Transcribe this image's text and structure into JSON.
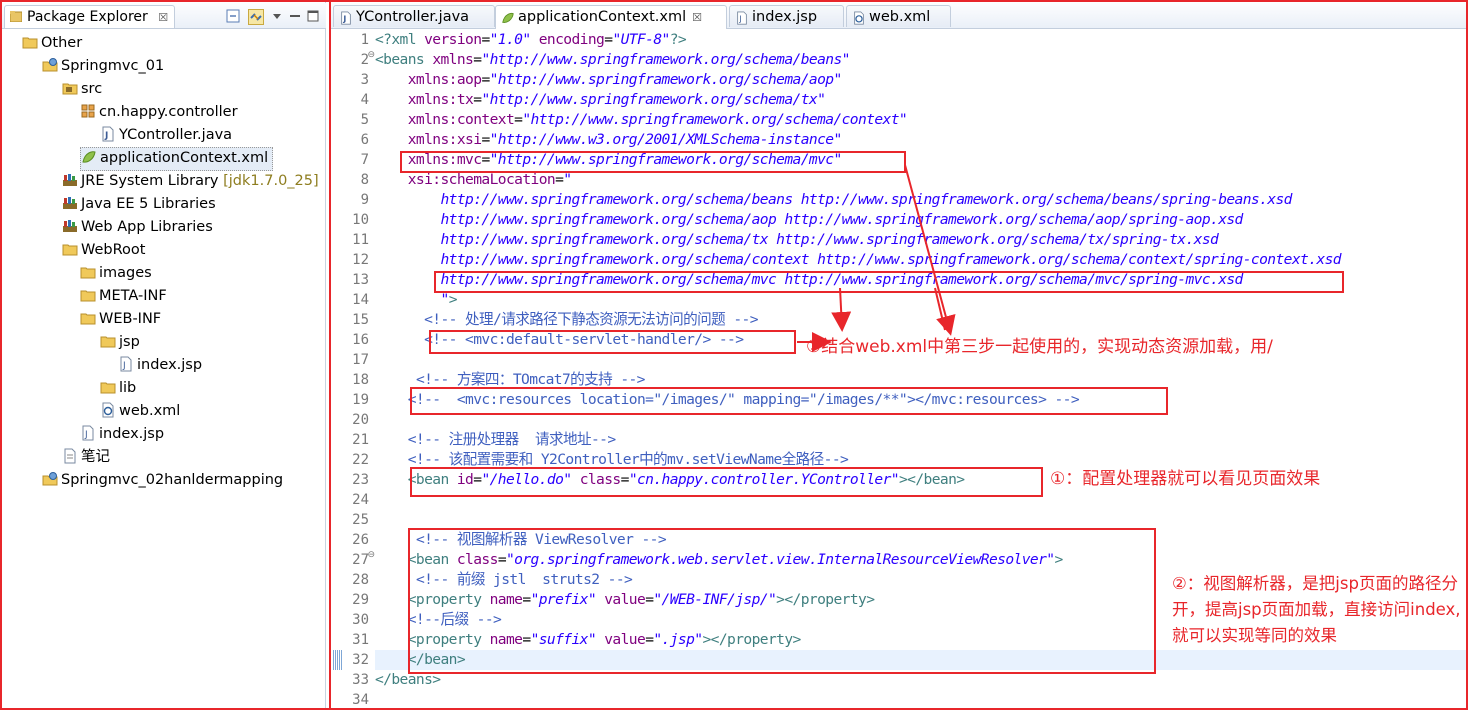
{
  "explorer": {
    "title": "Package Explorer",
    "close_glyph": "☒",
    "items": [
      {
        "label": "Other",
        "icon": "folder-icon"
      },
      {
        "label": "Springmvc_01",
        "icon": "web-project-icon"
      },
      {
        "label": "src",
        "icon": "source-folder-icon"
      },
      {
        "label": "cn.happy.controller",
        "icon": "package-icon"
      },
      {
        "label": "YController.java",
        "icon": "java-file-icon"
      },
      {
        "label": "applicationContext.xml",
        "icon": "spring-xml-icon"
      },
      {
        "label": "JRE System Library",
        "suffix": "[jdk1.7.0_25]",
        "icon": "library-icon"
      },
      {
        "label": "Java EE 5 Libraries",
        "icon": "library-icon"
      },
      {
        "label": "Web App Libraries",
        "icon": "library-icon"
      },
      {
        "label": "WebRoot",
        "icon": "folder-icon"
      },
      {
        "label": "images",
        "icon": "folder-icon"
      },
      {
        "label": "META-INF",
        "icon": "folder-icon"
      },
      {
        "label": "WEB-INF",
        "icon": "folder-icon"
      },
      {
        "label": "jsp",
        "icon": "folder-icon"
      },
      {
        "label": "index.jsp",
        "icon": "jsp-file-icon"
      },
      {
        "label": "lib",
        "icon": "folder-icon"
      },
      {
        "label": "web.xml",
        "icon": "xml-file-icon"
      },
      {
        "label": "index.jsp",
        "icon": "jsp-file-icon"
      },
      {
        "label": "笔记",
        "icon": "text-file-icon"
      },
      {
        "label": "Springmvc_02hanldermapping",
        "icon": "web-project-icon"
      }
    ]
  },
  "editor": {
    "tabs": [
      {
        "label": "YController.java",
        "icon": "java-file-icon"
      },
      {
        "label": "applicationContext.xml",
        "icon": "spring-xml-icon",
        "active": true
      },
      {
        "label": "index.jsp",
        "icon": "jsp-file-icon"
      },
      {
        "label": "web.xml",
        "icon": "xml-file-icon"
      }
    ],
    "close_glyph": "☒",
    "lines": [
      {
        "n": "1",
        "seg": [
          [
            "pi",
            "<?xml "
          ],
          [
            "attr",
            "version"
          ],
          [
            "t",
            "="
          ],
          [
            "val",
            "\"1.0\""
          ],
          [
            "t",
            " "
          ],
          [
            "attr",
            "encoding"
          ],
          [
            "t",
            "="
          ],
          [
            "val",
            "\"UTF-8\""
          ],
          [
            "pi",
            "?>"
          ]
        ]
      },
      {
        "n": "2",
        "fold": "⊖",
        "seg": [
          [
            "tag",
            "<beans "
          ],
          [
            "attr",
            "xmlns"
          ],
          [
            "t",
            "="
          ],
          [
            "val",
            "\"http://www.springframework.org/schema/beans\""
          ]
        ]
      },
      {
        "n": "3",
        "seg": [
          [
            "t",
            "    "
          ],
          [
            "attr",
            "xmlns:aop"
          ],
          [
            "t",
            "="
          ],
          [
            "val",
            "\"http://www.springframework.org/schema/aop\""
          ]
        ]
      },
      {
        "n": "4",
        "seg": [
          [
            "t",
            "    "
          ],
          [
            "attr",
            "xmlns:tx"
          ],
          [
            "t",
            "="
          ],
          [
            "val",
            "\"http://www.springframework.org/schema/tx\""
          ]
        ]
      },
      {
        "n": "5",
        "seg": [
          [
            "t",
            "    "
          ],
          [
            "attr",
            "xmlns:context"
          ],
          [
            "t",
            "="
          ],
          [
            "val",
            "\"http://www.springframework.org/schema/context\""
          ]
        ]
      },
      {
        "n": "6",
        "seg": [
          [
            "t",
            "    "
          ],
          [
            "attr",
            "xmlns:xsi"
          ],
          [
            "t",
            "="
          ],
          [
            "val",
            "\"http://www.w3.org/2001/XMLSchema-instance\""
          ]
        ]
      },
      {
        "n": "7",
        "seg": [
          [
            "t",
            "    "
          ],
          [
            "attr",
            "xmlns:mvc"
          ],
          [
            "t",
            "="
          ],
          [
            "val",
            "\"http://www.springframework.org/schema/mvc\""
          ]
        ]
      },
      {
        "n": "8",
        "seg": [
          [
            "t",
            "    "
          ],
          [
            "attr",
            "xsi:schemaLocation"
          ],
          [
            "t",
            "="
          ],
          [
            "val",
            "\""
          ]
        ]
      },
      {
        "n": "9",
        "seg": [
          [
            "t",
            "        "
          ],
          [
            "val",
            "http://www.springframework.org/schema/beans http://www.springframework.org/schema/beans/spring-beans.xsd"
          ]
        ]
      },
      {
        "n": "10",
        "seg": [
          [
            "t",
            "        "
          ],
          [
            "val",
            "http://www.springframework.org/schema/aop http://www.springframework.org/schema/aop/spring-aop.xsd"
          ]
        ]
      },
      {
        "n": "11",
        "seg": [
          [
            "t",
            "        "
          ],
          [
            "val",
            "http://www.springframework.org/schema/tx http://www.springframework.org/schema/tx/spring-tx.xsd"
          ]
        ]
      },
      {
        "n": "12",
        "seg": [
          [
            "t",
            "        "
          ],
          [
            "val",
            "http://www.springframework.org/schema/context http://www.springframework.org/schema/context/spring-context.xsd"
          ]
        ]
      },
      {
        "n": "13",
        "seg": [
          [
            "t",
            "        "
          ],
          [
            "val",
            "http://www.springframework.org/schema/mvc http://www.springframework.org/schema/mvc/spring-mvc.xsd"
          ]
        ]
      },
      {
        "n": "14",
        "seg": [
          [
            "t",
            "        "
          ],
          [
            "val",
            "\""
          ],
          [
            "tag",
            ">"
          ]
        ]
      },
      {
        "n": "15",
        "seg": [
          [
            "t",
            "      "
          ],
          [
            "com",
            "<!-- 处理/请求路径下静态资源无法访问的问题 -->"
          ]
        ]
      },
      {
        "n": "16",
        "seg": [
          [
            "t",
            "      "
          ],
          [
            "com",
            "<!-- <mvc:default-servlet-handler/> -->"
          ]
        ]
      },
      {
        "n": "17",
        "seg": [
          [
            "t",
            ""
          ]
        ]
      },
      {
        "n": "18",
        "seg": [
          [
            "t",
            "     "
          ],
          [
            "com",
            "<!-- 方案四：TOmcat7的支持 -->"
          ]
        ]
      },
      {
        "n": "19",
        "seg": [
          [
            "t",
            "    "
          ],
          [
            "com",
            "<!--  <mvc:resources location=\"/images/\" mapping=\"/images/**\"></mvc:resources> -->"
          ]
        ]
      },
      {
        "n": "20",
        "seg": [
          [
            "t",
            ""
          ]
        ]
      },
      {
        "n": "21",
        "seg": [
          [
            "t",
            "    "
          ],
          [
            "com",
            "<!-- 注册处理器  请求地址-->"
          ]
        ]
      },
      {
        "n": "22",
        "seg": [
          [
            "t",
            "    "
          ],
          [
            "com",
            "<!-- 该配置需要和 Y2Controller中的mv.setViewName全路径-->"
          ]
        ]
      },
      {
        "n": "23",
        "seg": [
          [
            "t",
            "    "
          ],
          [
            "tag",
            "<bean "
          ],
          [
            "attr",
            "id"
          ],
          [
            "t",
            "="
          ],
          [
            "val",
            "\"/hello.do\""
          ],
          [
            "t",
            " "
          ],
          [
            "attr",
            "class"
          ],
          [
            "t",
            "="
          ],
          [
            "val",
            "\"cn.happy.controller.YController\""
          ],
          [
            "tag",
            "></bean>"
          ]
        ]
      },
      {
        "n": "24",
        "seg": [
          [
            "t",
            ""
          ]
        ]
      },
      {
        "n": "25",
        "seg": [
          [
            "t",
            ""
          ]
        ]
      },
      {
        "n": "26",
        "seg": [
          [
            "t",
            "     "
          ],
          [
            "com",
            "<!-- 视图解析器 ViewResolver -->"
          ]
        ]
      },
      {
        "n": "27",
        "fold": "⊖",
        "seg": [
          [
            "t",
            "    "
          ],
          [
            "tag",
            "<bean "
          ],
          [
            "attr",
            "class"
          ],
          [
            "t",
            "="
          ],
          [
            "val",
            "\"org.springframework.web.servlet.view.InternalResourceViewResolver\""
          ],
          [
            "tag",
            ">"
          ]
        ]
      },
      {
        "n": "28",
        "seg": [
          [
            "t",
            "     "
          ],
          [
            "com",
            "<!-- 前缀 jstl  struts2 -->"
          ]
        ]
      },
      {
        "n": "29",
        "seg": [
          [
            "t",
            "    "
          ],
          [
            "tag",
            "<property "
          ],
          [
            "attr",
            "name"
          ],
          [
            "t",
            "="
          ],
          [
            "val",
            "\"prefix\""
          ],
          [
            "t",
            " "
          ],
          [
            "attr",
            "value"
          ],
          [
            "t",
            "="
          ],
          [
            "val",
            "\"/WEB-INF/jsp/\""
          ],
          [
            "tag",
            "></property>"
          ]
        ]
      },
      {
        "n": "30",
        "seg": [
          [
            "t",
            "    "
          ],
          [
            "com",
            "<!--后缀 -->"
          ]
        ]
      },
      {
        "n": "31",
        "seg": [
          [
            "t",
            "    "
          ],
          [
            "tag",
            "<property "
          ],
          [
            "attr",
            "name"
          ],
          [
            "t",
            "="
          ],
          [
            "val",
            "\"suffix\""
          ],
          [
            "t",
            " "
          ],
          [
            "attr",
            "value"
          ],
          [
            "t",
            "="
          ],
          [
            "val",
            "\".jsp\""
          ],
          [
            "tag",
            "></property>"
          ]
        ]
      },
      {
        "n": "32",
        "seg": [
          [
            "t",
            "    "
          ],
          [
            "tag",
            "</bean>"
          ]
        ]
      },
      {
        "n": "33",
        "seg": [
          [
            "tag",
            "</beans>"
          ]
        ]
      },
      {
        "n": "34",
        "seg": [
          [
            "t",
            ""
          ]
        ]
      }
    ]
  },
  "annotations": {
    "note_3": "③结合web.xml中第三步一起使用的，实现动态资源加载，用/",
    "note_1": "①：配置处理器就可以看见页面效果",
    "note_2": "②：视图解析器，是把jsp页面的路径分开，提高jsp页面加载，直接访问index,就可以实现等同的效果"
  },
  "colors": {
    "annotation": "#e8262b",
    "xml_tag": "#3f7f7f",
    "xml_attr": "#7f007f",
    "xml_value": "#2a00ff",
    "xml_comment": "#3f5fbf"
  }
}
